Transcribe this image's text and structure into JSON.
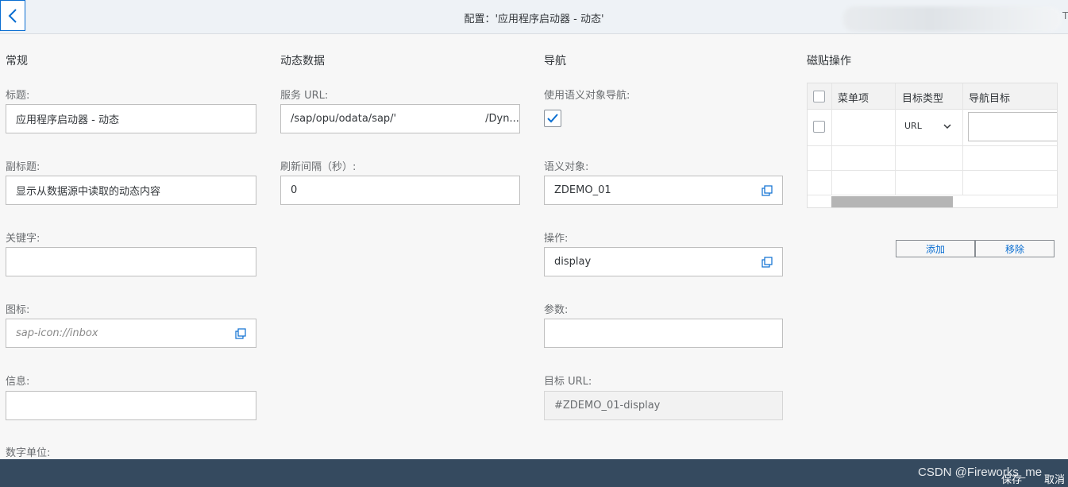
{
  "header": {
    "title": "配置：'应用程序启动器 - 动态'",
    "edge_text": "T"
  },
  "general": {
    "section_title": "常规",
    "title_label": "标题:",
    "title_value": "应用程序启动器 - 动态",
    "subtitle_label": "副标题:",
    "subtitle_value": "显示从数据源中读取的动态内容",
    "keywords_label": "关键字:",
    "keywords_value": "",
    "icon_label": "图标:",
    "icon_value": "sap-icon://inbox",
    "info_label": "信息:",
    "info_value": "",
    "number_unit_label": "数字单位:"
  },
  "dynamic": {
    "section_title": "动态数据",
    "service_url_label": "服务 URL:",
    "service_url_part1": "/sap/opu/odata/sap/'",
    "service_url_part2": "/Dyn...",
    "refresh_label": "刷新间隔（秒）:",
    "refresh_value": "0"
  },
  "navigation": {
    "section_title": "导航",
    "use_semantic_label": "使用语义对象导航:",
    "use_semantic_checked": true,
    "semantic_object_label": "语义对象:",
    "semantic_object_value": "ZDEMO_01",
    "action_label": "操作:",
    "action_value": "display",
    "params_label": "参数:",
    "params_value": "",
    "target_url_label": "目标 URL:",
    "target_url_value": "#ZDEMO_01-display"
  },
  "tile_actions": {
    "section_title": "磁贴操作",
    "columns": [
      "菜单项",
      "目标类型",
      "导航目标"
    ],
    "rows": [
      {
        "menu_item": "",
        "target_type": "URL",
        "nav_target": ""
      }
    ],
    "add_label": "添加",
    "remove_label": "移除"
  },
  "footer": {
    "watermark": "CSDN @Fireworks_me",
    "save_label": "保存",
    "cancel_label": "取消"
  },
  "colors": {
    "accent": "#0a6ed1",
    "footer_bg": "#354a5f",
    "header_bg": "#eef2f6"
  }
}
